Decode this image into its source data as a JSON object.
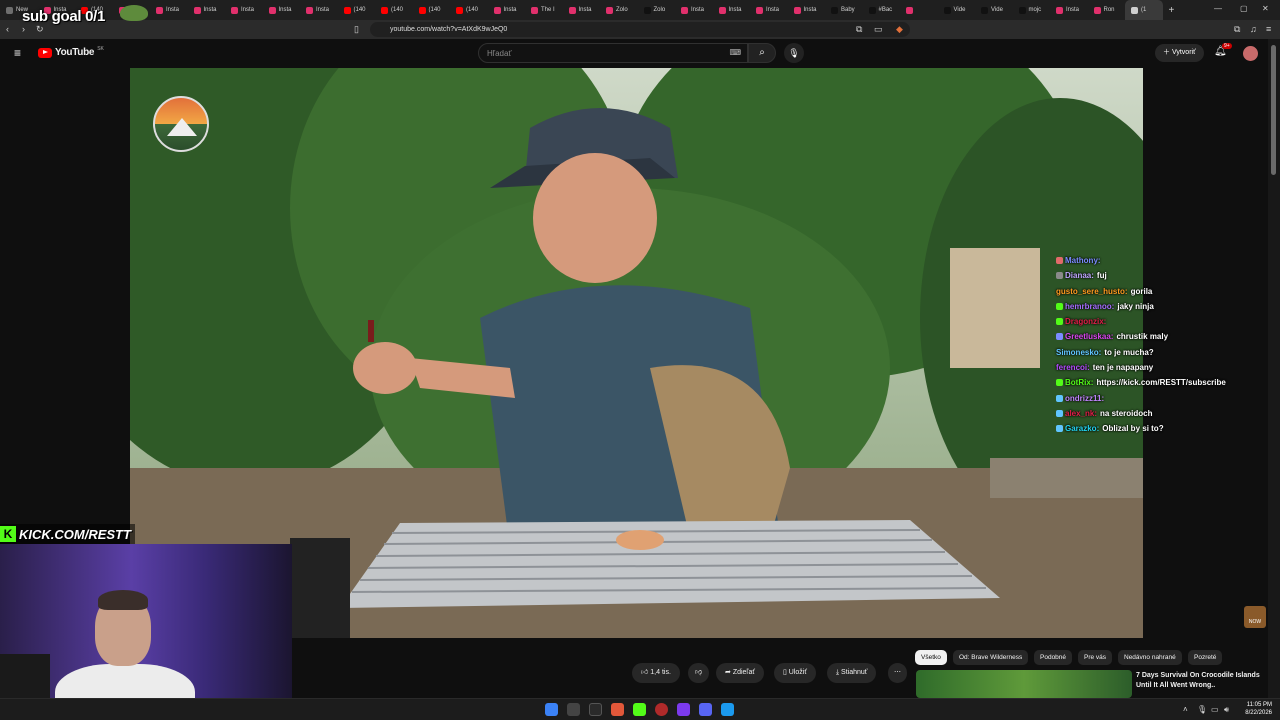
{
  "browser": {
    "tabs": [
      {
        "label": "New",
        "color": "#6e6e6e"
      },
      {
        "label": "Insta",
        "color": "#e1306c"
      },
      {
        "label": "(140",
        "color": "#ff0000"
      },
      {
        "label": "Insta",
        "color": "#e1306c"
      },
      {
        "label": "Insta",
        "color": "#e1306c"
      },
      {
        "label": "Insta",
        "color": "#e1306c"
      },
      {
        "label": "Insta",
        "color": "#e1306c"
      },
      {
        "label": "Insta",
        "color": "#e1306c"
      },
      {
        "label": "Insta",
        "color": "#e1306c"
      },
      {
        "label": "(140",
        "color": "#ff0000"
      },
      {
        "label": "(140",
        "color": "#ff0000"
      },
      {
        "label": "(140",
        "color": "#ff0000"
      },
      {
        "label": "(140",
        "color": "#ff0000"
      },
      {
        "label": "Insta",
        "color": "#e1306c"
      },
      {
        "label": "The I",
        "color": "#e1306c"
      },
      {
        "label": "Insta",
        "color": "#e1306c"
      },
      {
        "label": "Zolo",
        "color": "#e1306c"
      },
      {
        "label": "Zolo",
        "color": "#111111"
      },
      {
        "label": "Insta",
        "color": "#e1306c"
      },
      {
        "label": "Insta",
        "color": "#e1306c"
      },
      {
        "label": "Insta",
        "color": "#e1306c"
      },
      {
        "label": "Insta",
        "color": "#e1306c"
      },
      {
        "label": "Baby",
        "color": "#111111"
      },
      {
        "label": "#Bac",
        "color": "#111111"
      },
      {
        "label": "",
        "color": "#e1306c"
      },
      {
        "label": "Vide",
        "color": "#111111"
      },
      {
        "label": "Vide",
        "color": "#111111"
      },
      {
        "label": "mojc",
        "color": "#111111"
      },
      {
        "label": "Insta",
        "color": "#e1306c"
      },
      {
        "label": "Ron",
        "color": "#e1306c"
      },
      {
        "label": "(1",
        "color": "#cfcfcf",
        "active": true
      }
    ],
    "url": "youtube.com/watch?v=AtXdK9wJeQ0"
  },
  "youtube": {
    "logo_text": "YouTube",
    "region": "SK",
    "search_placeholder": "Hľadať",
    "create_label": "Vytvoriť",
    "notif_count": "9+",
    "actions": {
      "likes": "1,4 tis.",
      "share": "Zdieľať",
      "save": "Uložiť",
      "download": "Stiahnuť"
    },
    "chips": [
      "Všetko",
      "Od: Brave Wilderness",
      "Podobné",
      "Pre vás",
      "Nedávno nahrané",
      "Pozreté"
    ],
    "recommended": {
      "title": "7 Days Survival On Crocodile Islands Until It All Went Wrong.."
    }
  },
  "overlay": {
    "sub_goal": "sub goal 0/1",
    "kick_url": "KICK.COM/RESTT",
    "now_label": "NOW",
    "chat": [
      {
        "user": "Mathony:",
        "text": "",
        "color": "#7b8cff",
        "icon": "#e26a6a"
      },
      {
        "user": "Dianaa:",
        "text": "fuj",
        "color": "#bfa6ff",
        "icon": "#8a8a8a"
      },
      {
        "user": "gusto_sere_husto:",
        "text": "gorila",
        "color": "#ff9b1f",
        "icon": ""
      },
      {
        "user": "hemrbranoo:",
        "text": "jaky ninja",
        "color": "#a66cff",
        "icon": "#53fc18"
      },
      {
        "user": "Dragonzix:",
        "text": "",
        "color": "#e11d48",
        "icon": "#53fc18"
      },
      {
        "user": "Greetluskaa:",
        "text": "chrustik maly",
        "color": "#d946ef",
        "icon": "#7b8cff"
      },
      {
        "user": "Simonesko:",
        "text": "to je mucha?",
        "color": "#60c5ff",
        "icon": ""
      },
      {
        "user": "ferencoi:",
        "text": "ten je napapany",
        "color": "#b44cff",
        "icon": ""
      },
      {
        "user": "BotRix:",
        "text": "https://kick.com/RESTT/subscribe",
        "color": "#53fc18",
        "icon": "#53fc18"
      },
      {
        "user": "ondrizz11:",
        "text": "",
        "color": "#c084fc",
        "icon": "#60c5ff"
      },
      {
        "user": "alex_nk:",
        "text": "na steroidoch",
        "color": "#e11d48",
        "icon": "#60c5ff"
      },
      {
        "user": "Garazko:",
        "text": "Oblizal by si to?",
        "color": "#22d3ee",
        "icon": "#60c5ff"
      }
    ]
  },
  "taskbar": {
    "time": "11:05 PM",
    "date": "8/22/2026"
  }
}
